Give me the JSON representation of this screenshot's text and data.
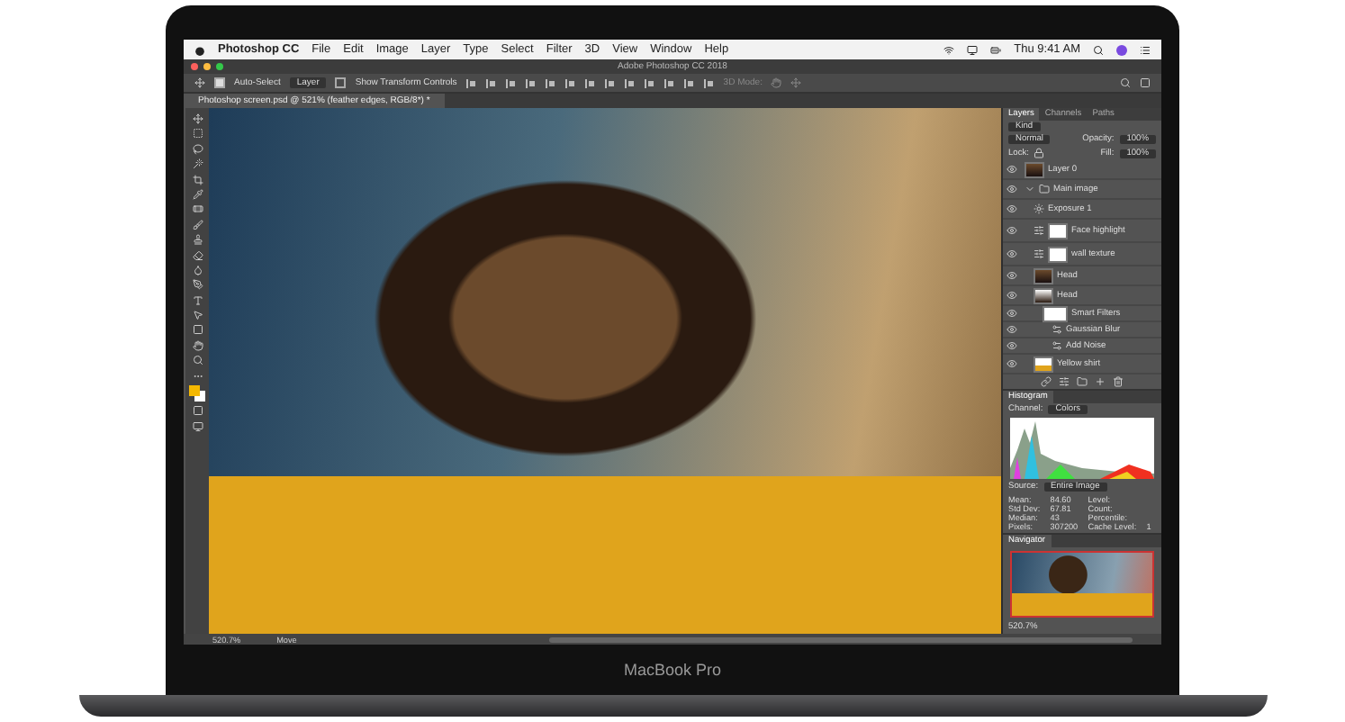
{
  "menu_bar": {
    "app": "Photoshop CC",
    "items": [
      "File",
      "Edit",
      "Image",
      "Layer",
      "Type",
      "Select",
      "Filter",
      "3D",
      "View",
      "Window",
      "Help"
    ],
    "clock": "Thu 9:41 AM"
  },
  "window": {
    "title": "Adobe Photoshop CC 2018"
  },
  "options_bar": {
    "auto_select": {
      "label": "Auto-Select",
      "checked": true
    },
    "target": "Layer",
    "transform": {
      "label": "Show Transform Controls",
      "checked": false
    },
    "mode_3d": "3D Mode:"
  },
  "document_tab": {
    "title": "Photoshop screen.psd @ 521% (feather edges, RGB/8*) *"
  },
  "layers_panel": {
    "tabs": [
      {
        "label": "Layers",
        "selected": true
      },
      {
        "label": "Channels",
        "selected": false
      },
      {
        "label": "Paths",
        "selected": false
      }
    ],
    "filter": "Kind",
    "blend_mode": "Normal",
    "opacity_label": "Opacity:",
    "opacity": "100%",
    "lock_label": "Lock:",
    "fill_label": "Fill:",
    "fill": "100%",
    "layers": [
      {
        "name": "Layer 0",
        "kind": "pixel",
        "visible": true
      },
      {
        "name": "Main image",
        "kind": "group",
        "visible": true,
        "expanded": true,
        "children": [
          {
            "name": "Exposure 1",
            "kind": "adjustment",
            "visible": true
          },
          {
            "name": "Face highlight",
            "kind": "masked_adjustment",
            "visible": true
          },
          {
            "name": "wall texture",
            "kind": "masked_adjustment",
            "visible": true
          },
          {
            "name": "Head",
            "kind": "pixel",
            "visible": true
          },
          {
            "name": "Head",
            "kind": "smart_object",
            "visible": true,
            "children": [
              {
                "name": "Smart Filters",
                "kind": "smart_filters",
                "visible": true,
                "children": [
                  {
                    "name": "Gaussian Blur",
                    "kind": "filter",
                    "visible": true
                  },
                  {
                    "name": "Add Noise",
                    "kind": "filter",
                    "visible": true
                  }
                ]
              }
            ]
          },
          {
            "name": "Yellow shirt",
            "kind": "shirt",
            "visible": true
          }
        ]
      }
    ]
  },
  "histogram": {
    "tab": "Histogram",
    "channel_label": "Channel:",
    "channel": "Colors",
    "source_label": "Source:",
    "source": "Entire Image",
    "stats_left": [
      {
        "label": "Mean:",
        "value": "84.60"
      },
      {
        "label": "Std Dev:",
        "value": "67.81"
      },
      {
        "label": "Median:",
        "value": "43"
      },
      {
        "label": "Pixels:",
        "value": "307200"
      }
    ],
    "stats_right": [
      {
        "label": "Level:"
      },
      {
        "label": "Count:"
      },
      {
        "label": "Percentile:"
      },
      {
        "label": "Cache Level:",
        "value": "1"
      }
    ]
  },
  "navigator": {
    "tab": "Navigator",
    "zoom": "520.7%"
  },
  "status_bar": {
    "zoom": "520.7%",
    "tool": "Move"
  },
  "laptop": {
    "label": "MacBook Pro"
  }
}
